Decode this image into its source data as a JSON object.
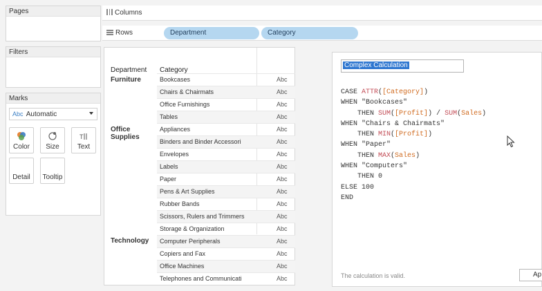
{
  "left": {
    "pages_title": "Pages",
    "filters_title": "Filters",
    "marks_title": "Marks",
    "mark_type_abc": "Abc",
    "mark_type": "Automatic",
    "buttons": [
      {
        "label": "Color",
        "icon": "color-icon"
      },
      {
        "label": "Size",
        "icon": "size-icon"
      },
      {
        "label": "Text",
        "icon": "text-icon"
      },
      {
        "label": "Detail",
        "icon": ""
      },
      {
        "label": "Tooltip",
        "icon": ""
      }
    ]
  },
  "shelves": {
    "columns_label": "Columns",
    "rows_label": "Rows",
    "rows_pills": [
      "Department",
      "Category"
    ]
  },
  "table": {
    "headers": [
      "Department",
      "Category"
    ],
    "departments": [
      "Furniture",
      "Office\nSupplies",
      "Technology"
    ],
    "rows": [
      {
        "category": "Bookcases",
        "value": "Abc"
      },
      {
        "category": "Chairs & Chairmats",
        "value": "Abc"
      },
      {
        "category": "Office Furnishings",
        "value": "Abc"
      },
      {
        "category": "Tables",
        "value": "Abc"
      },
      {
        "category": "Appliances",
        "value": "Abc"
      },
      {
        "category": "Binders and Binder Accessori",
        "value": "Abc"
      },
      {
        "category": "Envelopes",
        "value": "Abc"
      },
      {
        "category": "Labels",
        "value": "Abc"
      },
      {
        "category": "Paper",
        "value": "Abc"
      },
      {
        "category": "Pens & Art Supplies",
        "value": "Abc"
      },
      {
        "category": "Rubber Bands",
        "value": "Abc"
      },
      {
        "category": "Scissors, Rulers and Trimmers",
        "value": "Abc"
      },
      {
        "category": "Storage & Organization",
        "value": "Abc"
      },
      {
        "category": "Computer Peripherals",
        "value": "Abc"
      },
      {
        "category": "Copiers and Fax",
        "value": "Abc"
      },
      {
        "category": "Office Machines",
        "value": "Abc"
      },
      {
        "category": "Telephones and Communicati",
        "value": "Abc"
      }
    ]
  },
  "calc": {
    "name": "Complex Calculation",
    "code_lines": [
      "CASE ATTR([Category])",
      "WHEN \"Bookcases\"",
      "    THEN SUM([Profit]) / SUM(Sales)",
      "WHEN \"Chairs & Chairmats\"",
      "    THEN MIN([Profit])",
      "WHEN \"Paper\"",
      "    THEN MAX(Sales)",
      "WHEN \"Computers\"",
      "    THEN 0",
      "ELSE 100",
      "END"
    ],
    "status": "The calculation is valid.",
    "apply_label": "Ap"
  }
}
